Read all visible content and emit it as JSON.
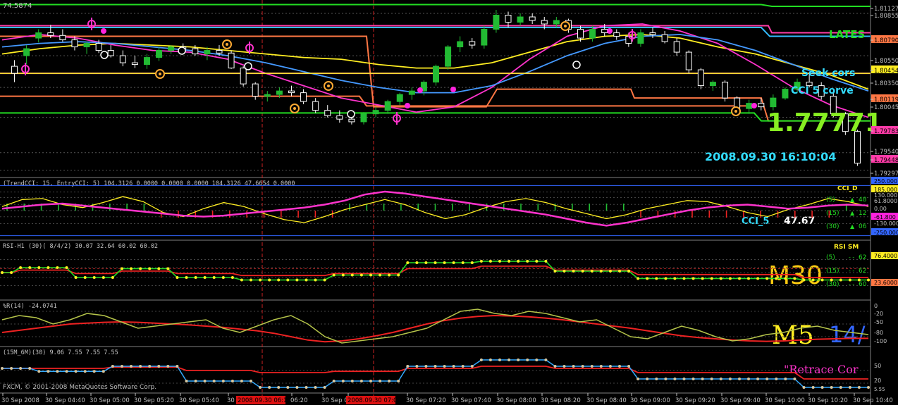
{
  "chart_data": {
    "type": "line",
    "instrument_note": "FXCM GBP-like price chart (M5) with indicator sub-windows",
    "main": {
      "top_left_label": "74.5874",
      "price_axis": [
        "1.81127",
        "1.80855",
        "1.80790",
        "1.80550",
        "1.80454",
        "1.80350",
        "1.80119",
        "1.80045",
        "1.79783",
        "1.79540",
        "1.79448",
        "1.79297"
      ],
      "big_price": "1.77771",
      "datetime": "2008.09.30 16:10:04",
      "labels": [
        "LATES",
        "Seek cors",
        "CCI 5 corve"
      ],
      "ylim": [
        1.7925,
        1.812
      ],
      "candles": [
        [
          1.8048,
          1.8055,
          1.803,
          1.804
        ],
        [
          1.806,
          1.8072,
          1.805,
          1.8068
        ],
        [
          1.808,
          1.809,
          1.8075,
          1.8086
        ],
        [
          1.8086,
          1.8095,
          1.808,
          1.8083
        ],
        [
          1.8083,
          1.809,
          1.8076,
          1.8078
        ],
        [
          1.8078,
          1.8082,
          1.8066,
          1.807
        ],
        [
          1.807,
          1.8076,
          1.8062,
          1.8074
        ],
        [
          1.8074,
          1.8078,
          1.8063,
          1.8066
        ],
        [
          1.8066,
          1.8072,
          1.8058,
          1.806
        ],
        [
          1.806,
          1.8066,
          1.8048,
          1.8052
        ],
        [
          1.8052,
          1.806,
          1.8046,
          1.805
        ],
        [
          1.805,
          1.8062,
          1.8045,
          1.8058
        ],
        [
          1.8058,
          1.807,
          1.8054,
          1.8066
        ],
        [
          1.8066,
          1.8072,
          1.8062,
          1.807
        ],
        [
          1.807,
          1.8074,
          1.8064,
          1.8068
        ],
        [
          1.8068,
          1.8072,
          1.806,
          1.8062
        ],
        [
          1.8062,
          1.807,
          1.8055,
          1.8066
        ],
        [
          1.8066,
          1.8072,
          1.806,
          1.8063
        ],
        [
          1.8063,
          1.8066,
          1.8045,
          1.8046
        ],
        [
          1.8046,
          1.8048,
          1.8025,
          1.8028
        ],
        [
          1.8028,
          1.803,
          1.801,
          1.8014
        ],
        [
          1.8014,
          1.802,
          1.8008,
          1.8016
        ],
        [
          1.8016,
          1.8024,
          1.8012,
          1.802
        ],
        [
          1.802,
          1.8026,
          1.8014,
          1.8018
        ],
        [
          1.8018,
          1.8022,
          1.8005,
          1.8008
        ],
        [
          1.8008,
          1.8012,
          1.7995,
          1.7998
        ],
        [
          1.7998,
          1.8004,
          1.799,
          1.7992
        ],
        [
          1.7992,
          1.7998,
          1.7984,
          1.7988
        ],
        [
          1.7988,
          1.7992,
          1.7982,
          1.7985
        ],
        [
          1.7985,
          1.7996,
          1.7982,
          1.7994
        ],
        [
          1.7994,
          1.8002,
          1.799,
          1.7998
        ],
        [
          1.7998,
          1.801,
          1.7994,
          1.8008
        ],
        [
          1.8008,
          1.8018,
          1.8004,
          1.8016
        ],
        [
          1.8016,
          1.8024,
          1.801,
          1.802
        ],
        [
          1.802,
          1.8032,
          1.8015,
          1.803
        ],
        [
          1.803,
          1.805,
          1.8026,
          1.8048
        ],
        [
          1.8048,
          1.8072,
          1.8044,
          1.807
        ],
        [
          1.807,
          1.8082,
          1.8064,
          1.8076
        ],
        [
          1.8076,
          1.808,
          1.8068,
          1.8072
        ],
        [
          1.8072,
          1.8094,
          1.8068,
          1.809
        ],
        [
          1.809,
          1.8112,
          1.8086,
          1.8106
        ],
        [
          1.8106,
          1.811,
          1.8092,
          1.8098
        ],
        [
          1.8098,
          1.8108,
          1.8094,
          1.8104
        ],
        [
          1.8104,
          1.8108,
          1.8096,
          1.81
        ],
        [
          1.81,
          1.8104,
          1.809,
          1.8096
        ],
        [
          1.8096,
          1.8104,
          1.8092,
          1.81
        ],
        [
          1.81,
          1.8102,
          1.8086,
          1.809
        ],
        [
          1.809,
          1.8094,
          1.8076,
          1.808
        ],
        [
          1.808,
          1.8094,
          1.8076,
          1.809
        ],
        [
          1.809,
          1.8096,
          1.8082,
          1.8086
        ],
        [
          1.8086,
          1.809,
          1.8078,
          1.8082
        ],
        [
          1.8082,
          1.8086,
          1.807,
          1.8074
        ],
        [
          1.8074,
          1.809,
          1.807,
          1.8086
        ],
        [
          1.8086,
          1.8092,
          1.808,
          1.8084
        ],
        [
          1.8084,
          1.8088,
          1.8074,
          1.8076
        ],
        [
          1.8076,
          1.808,
          1.806,
          1.8064
        ],
        [
          1.8064,
          1.8066,
          1.804,
          1.8044
        ],
        [
          1.8044,
          1.8046,
          1.8022,
          1.8026
        ],
        [
          1.8026,
          1.8032,
          1.802,
          1.803
        ],
        [
          1.803,
          1.8032,
          1.8008,
          1.8012
        ],
        [
          1.8012,
          1.8014,
          1.7998,
          1.8
        ],
        [
          1.8,
          1.801,
          1.7994,
          1.8006
        ],
        [
          1.8006,
          1.8012,
          1.7998,
          1.8002
        ],
        [
          1.8002,
          1.8016,
          1.7998,
          1.8012
        ],
        [
          1.8012,
          1.8024,
          1.801,
          1.8022
        ],
        [
          1.8022,
          1.8034,
          1.8018,
          1.803
        ],
        [
          1.803,
          1.804,
          1.8024,
          1.8026
        ],
        [
          1.8026,
          1.803,
          1.801,
          1.8014
        ],
        [
          1.8014,
          1.8018,
          1.799,
          1.7994
        ],
        [
          1.7994,
          1.7996,
          1.797,
          1.7974
        ],
        [
          1.7974,
          1.7976,
          1.7935,
          1.7938
        ]
      ],
      "hlines": [
        {
          "color": "#22dd22",
          "y": 1.8118
        },
        {
          "color": "#ff3ba8",
          "y": 1.8094
        },
        {
          "color": "#ff3ba8",
          "y": 1.804
        },
        {
          "color": "#33bbff",
          "y": 1.8092
        },
        {
          "color": "#ff7744",
          "y": 1.8082
        },
        {
          "color": "#ff7744",
          "y": 1.8014
        },
        {
          "color": "#22dd22",
          "y": 1.7995
        }
      ],
      "ma_lines": [
        {
          "color": "#ffee22",
          "values": [
            1.8062,
            1.8068,
            1.8072,
            1.8074,
            1.8072,
            1.807,
            1.8066,
            1.8062,
            1.8058,
            1.8056,
            1.805,
            1.8046,
            1.8046,
            1.8052,
            1.8064,
            1.8076,
            1.8082,
            1.8084,
            1.808,
            1.807,
            1.8062,
            1.805,
            1.8038,
            1.8022
          ]
        },
        {
          "color": "#ff33cc",
          "values": [
            1.8078,
            1.8084,
            1.808,
            1.8072,
            1.8066,
            1.8064,
            1.8056,
            1.804,
            1.8026,
            1.8012,
            1.8004,
            1.7996,
            1.8002,
            1.8024,
            1.8056,
            1.8082,
            1.8094,
            1.8096,
            1.8088,
            1.8074,
            1.805,
            1.8024,
            1.8004,
            1.799
          ]
        },
        {
          "color": "#4499ff",
          "values": [
            1.807,
            1.8074,
            1.8076,
            1.8074,
            1.807,
            1.8066,
            1.806,
            1.8052,
            1.8042,
            1.8032,
            1.8024,
            1.8018,
            1.8018,
            1.8026,
            1.8042,
            1.806,
            1.8074,
            1.8082,
            1.8084,
            1.8078,
            1.8066,
            1.805,
            1.8034,
            1.802
          ]
        }
      ]
    },
    "cci": {
      "title": "(TrendCCI: 15, EntryCCI: 5)  104.3126  0.0000  0.0000  0.0000  104.3126  47.6654  0.0000",
      "axis": [
        "250.000",
        "185.000",
        "130.000",
        "61.8000",
        "0.00",
        "-61.800",
        "-130.000",
        "-250.000"
      ],
      "overlay_title": "CCI_D",
      "rows": [
        {
          "p": "(5)",
          "v": "48"
        },
        {
          "p": "(15)",
          "v": "12"
        },
        {
          "p": "(30)",
          "v": "06"
        }
      ],
      "cci5_label": "CCI_5",
      "cci5_value": "47.67",
      "yellow": [
        40,
        110,
        120,
        60,
        30,
        80,
        140,
        90,
        -20,
        -60,
        20,
        80,
        40,
        -30,
        -90,
        -120,
        -60,
        10,
        60,
        110,
        60,
        -20,
        -80,
        -40,
        30,
        90,
        120,
        80,
        20,
        -30,
        -80,
        -40,
        20,
        60,
        100,
        90,
        40,
        -20,
        -60,
        10,
        60,
        120,
        90,
        40
      ],
      "magenta": [
        20,
        40,
        60,
        70,
        50,
        30,
        10,
        -10,
        -30,
        -50,
        -60,
        -50,
        -30,
        -10,
        10,
        30,
        60,
        100,
        160,
        190,
        170,
        140,
        110,
        80,
        50,
        20,
        -10,
        -40,
        -80,
        -120,
        -150,
        -120,
        -80,
        -40,
        0,
        30,
        50,
        60,
        40,
        20,
        30,
        50,
        60,
        50
      ],
      "hist": [
        1,
        1,
        1,
        1,
        1,
        1,
        1,
        1,
        1,
        -1,
        -1,
        -1,
        -1,
        -1,
        -1,
        -1,
        -1,
        -1,
        -1,
        -1,
        1,
        1,
        1,
        1,
        1,
        1,
        1,
        1,
        1,
        1,
        1,
        1,
        1,
        1,
        1,
        1,
        1,
        -1,
        -1,
        -1,
        -1,
        -1,
        -1,
        -1,
        -1,
        -1,
        -1,
        -1,
        -1,
        1
      ]
    },
    "rsi": {
      "title": "RSI-H1  (30)( 8/4/2)  30.07  32.64  60.02  60.02",
      "axis": [
        "76.4000",
        "23.6000"
      ],
      "overlay_title": "RSI SM",
      "rows": [
        {
          "p": "(5)",
          "v": "62"
        },
        {
          "p": "(15)",
          "v": "62"
        },
        {
          "p": "(30)",
          "v": "60"
        }
      ],
      "green": [
        50,
        50,
        60,
        60,
        60,
        60,
        60,
        60,
        40,
        40,
        40,
        40,
        40,
        58,
        58,
        58,
        58,
        58,
        58,
        40,
        40,
        40,
        40,
        40,
        40,
        40,
        35,
        35,
        35,
        35,
        35,
        35,
        35,
        35,
        35,
        35,
        45,
        45,
        45,
        45,
        45,
        45,
        45,
        45,
        70,
        70,
        70,
        70,
        70,
        70,
        70,
        70,
        73,
        73,
        73,
        73,
        73,
        73,
        73,
        73,
        53,
        53,
        53,
        53,
        53,
        53,
        53,
        53,
        53,
        38,
        38,
        38,
        38,
        38,
        38,
        38,
        38,
        38,
        38,
        38,
        38,
        38,
        38,
        38,
        38,
        38,
        38,
        35,
        35,
        35,
        35,
        35,
        35,
        35,
        35
      ],
      "red": [
        50,
        50,
        55,
        55,
        55,
        55,
        55,
        55,
        48,
        48,
        48,
        48,
        48,
        53,
        53,
        53,
        53,
        53,
        53,
        48,
        48,
        48,
        48,
        48,
        48,
        48,
        44,
        44,
        44,
        44,
        44,
        44,
        44,
        44,
        44,
        44,
        48,
        48,
        48,
        48,
        48,
        48,
        48,
        48,
        58,
        58,
        58,
        58,
        58,
        58,
        58,
        58,
        63,
        63,
        63,
        63,
        63,
        63,
        63,
        63,
        55,
        55,
        55,
        55,
        55,
        55,
        55,
        55,
        55,
        46,
        46,
        46,
        46,
        46,
        46,
        46,
        46,
        46,
        46,
        46,
        46,
        46,
        46,
        46,
        46,
        46,
        46,
        40,
        40,
        40,
        40,
        40,
        40,
        40,
        40
      ],
      "big_label": "M30",
      "ylim": [
        0,
        100
      ]
    },
    "wpr": {
      "title": "%R(14) -24.0741",
      "axis": [
        "0",
        "-20",
        "-50",
        "-80",
        "-100"
      ],
      "olive": [
        -40,
        -30,
        -35,
        -50,
        -40,
        -25,
        -30,
        -45,
        -60,
        -55,
        -50,
        -45,
        -40,
        -60,
        -70,
        -55,
        -40,
        -30,
        -50,
        -80,
        -95,
        -90,
        -85,
        -80,
        -70,
        -60,
        -40,
        -20,
        -15,
        -25,
        -30,
        -20,
        -25,
        -35,
        -45,
        -40,
        -60,
        -80,
        -85,
        -70,
        -55,
        -65,
        -80,
        -90,
        -85,
        -75,
        -70,
        -60,
        -55,
        -65,
        -70,
        -75
      ],
      "red": [
        -70,
        -65,
        -60,
        -55,
        -50,
        -48,
        -46,
        -45,
        -46,
        -48,
        -50,
        -52,
        -55,
        -58,
        -62,
        -66,
        -72,
        -80,
        -88,
        -92,
        -90,
        -85,
        -78,
        -70,
        -60,
        -50,
        -42,
        -36,
        -32,
        -30,
        -31,
        -33,
        -36,
        -40,
        -45,
        -50,
        -55,
        -60,
        -66,
        -72,
        -78,
        -82,
        -85,
        -88,
        -90,
        -91,
        -90,
        -88,
        -86,
        -85,
        -84,
        -84
      ],
      "big_label": "M5",
      "big_label2": "14/",
      "ylim": [
        -100,
        0
      ]
    },
    "stoch": {
      "title": "(15M_6M)(30) 9.06  7.55  7.55  7.55",
      "axis": [
        "50",
        "20",
        "5.55"
      ],
      "right_label": "\"Retrace Cor",
      "copyright": "FXCM, © 2001-2008 MetaQuotes Software Corp.",
      "steps": [
        55,
        55,
        55,
        55,
        48,
        48,
        48,
        48,
        48,
        48,
        48,
        48,
        60,
        60,
        60,
        60,
        60,
        60,
        60,
        60,
        25,
        25,
        25,
        25,
        25,
        25,
        25,
        25,
        10,
        10,
        10,
        10,
        10,
        10,
        10,
        10,
        25,
        25,
        25,
        25,
        25,
        25,
        25,
        25,
        60,
        60,
        60,
        60,
        60,
        60,
        60,
        60,
        75,
        75,
        75,
        75,
        75,
        75,
        75,
        75,
        60,
        60,
        60,
        60,
        60,
        60,
        60,
        60,
        60,
        30,
        30,
        30,
        30,
        30,
        30,
        30,
        30,
        30,
        30,
        30,
        30,
        30,
        30,
        30,
        30,
        30,
        30,
        10,
        10,
        10,
        10,
        10,
        10,
        10,
        10
      ],
      "red": [
        55,
        55,
        55,
        55,
        55,
        55,
        55,
        55,
        55,
        55,
        55,
        55,
        58,
        58,
        58,
        58,
        58,
        58,
        58,
        58,
        50,
        50,
        50,
        50,
        50,
        50,
        50,
        50,
        45,
        45,
        45,
        45,
        45,
        45,
        45,
        45,
        48,
        48,
        48,
        48,
        48,
        48,
        48,
        48,
        55,
        55,
        55,
        55,
        55,
        55,
        55,
        55,
        60,
        60,
        60,
        60,
        60,
        60,
        60,
        60,
        55,
        55,
        55,
        55,
        55,
        55,
        55,
        55,
        55,
        45,
        45,
        45,
        45,
        45,
        45,
        45,
        45,
        45,
        45,
        45,
        45,
        45,
        45,
        45,
        45,
        45,
        45,
        30,
        30,
        30,
        30,
        30,
        30,
        30,
        30
      ],
      "ylim": [
        0,
        100
      ]
    },
    "time_axis": {
      "labels": [
        "30 Sep 2008",
        "30 Sep 04:40",
        "30 Sep 05:00",
        "30 Sep 05:20",
        "30 Sep 05:40",
        "30 2008.09.30 06:15",
        "06:20",
        "30 Sep 06",
        "2008.09.30 07:05",
        "30 Sep 07:20",
        "30 Sep 07:40",
        "30 Sep 08:00",
        "30 Sep 08:20",
        "30 Sep 08:40",
        "30 Sep 09:00",
        "30 Sep 09:20",
        "30 Sep 09:40",
        "30 Sep 10:00",
        "30 Sep 10:20",
        "30 Sep 10:40"
      ],
      "highlight": [
        "2008.09.30 06:15",
        "2008.09.30 07:05"
      ]
    },
    "colors": {
      "bg": "#000000",
      "grid": "#333333",
      "axis": "#c0c0c0",
      "bull": "#22bb33",
      "bear": "#ffffff",
      "wpr_line": "#b5c44a",
      "red": "#ee2222",
      "yellow": "#ffee22",
      "magenta": "#ff33cc",
      "cyan": "#33ddff",
      "green": "#22dd22",
      "orange": "#ffaa33"
    }
  }
}
